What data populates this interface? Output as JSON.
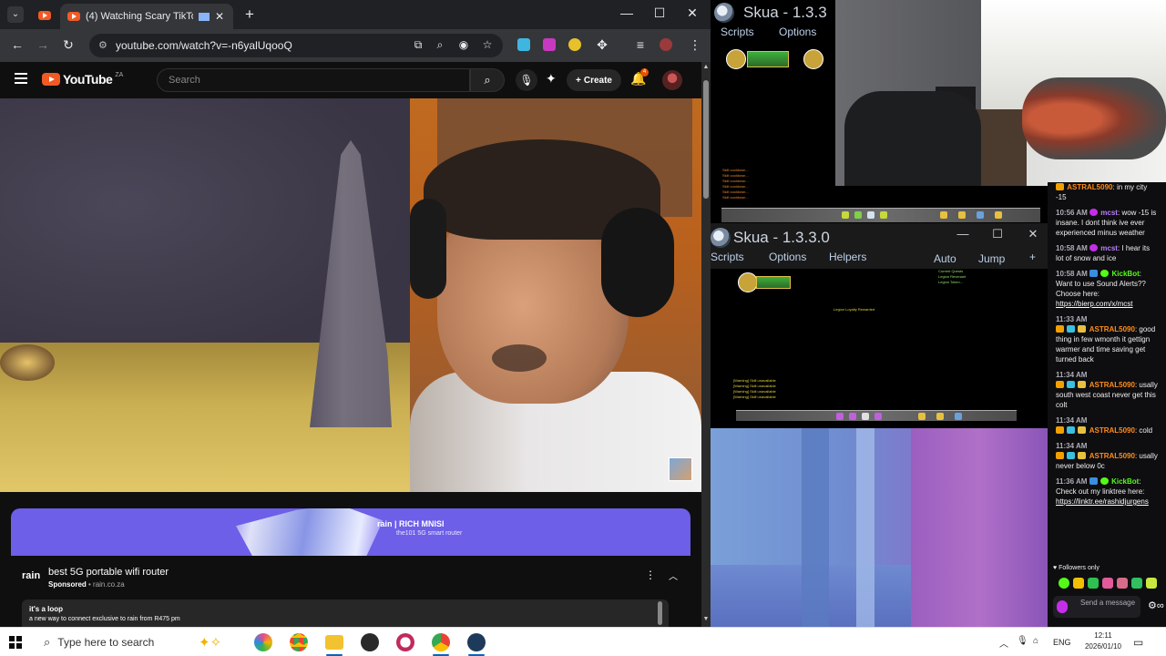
{
  "browser": {
    "tab_title": "(4) Watching Scary TikToks",
    "url": "youtube.com/watch?v=-n6yalUqooQ",
    "tab_close": "✕",
    "new_tab": "+",
    "win_minimize": "—",
    "win_maximize": "☐",
    "win_close": "✕"
  },
  "youtube": {
    "logo_text": "YouTube",
    "country_code": "ZA",
    "search_placeholder": "Search",
    "create_label": "Create",
    "notification_count": "4"
  },
  "ad": {
    "banner_brand": "rain  |  RICH MNISI",
    "banner_tagline": "the101 5G smart router",
    "logo": "rain",
    "title": "best 5G portable wifi router",
    "sponsored": "Sponsored",
    "domain": "rain.co.za",
    "card_title": "it's a loop",
    "card_text": "a new way to connect exclusive to rain from R475 pm"
  },
  "skua": {
    "title_top": "Skua - 1.3.3",
    "title": "Skua - 1.3.3.0",
    "menu_top": [
      "Scripts",
      "Options"
    ],
    "menu": [
      "Scripts",
      "Options",
      "Helpers",
      "Auto",
      "Jump",
      "+"
    ],
    "minimize": "—",
    "maximize": "☐",
    "close": "✕"
  },
  "chat": {
    "messages": [
      {
        "time": "",
        "user": "ASTRAL5090",
        "text": "in my city -15",
        "user_color": "orange"
      },
      {
        "time": "10:56 AM",
        "user": "mcst",
        "text": "wow -15 is insane. I dont think ive ever experienced minus weather",
        "user_color": "purple"
      },
      {
        "time": "10:58 AM",
        "user": "mcst",
        "text": "I hear its lot of snow and ice",
        "user_color": "purple"
      },
      {
        "time": "10:58 AM",
        "user": "KickBot",
        "text": "Want to use Sound Alerts?? Choose here:",
        "link": "https://bierp.com/x/mcst",
        "user_color": "green"
      },
      {
        "time": "11:33 AM",
        "user": "ASTRAL5090",
        "text": "good thing in few wmonth it gettign warmer and time saving get turned back",
        "user_color": "orange"
      },
      {
        "time": "11:34 AM",
        "user": "ASTRAL5090",
        "text": "usally south west coast never get this colt",
        "user_color": "orange"
      },
      {
        "time": "11:34 AM",
        "user": "ASTRAL5090",
        "text": "cold",
        "user_color": "orange"
      },
      {
        "time": "11:34 AM",
        "user": "ASTRAL5090",
        "text": "usally never below 0c",
        "user_color": "orange"
      },
      {
        "time": "11:36 AM",
        "user": "KickBot",
        "text": "Check out my linktree here:",
        "link": "https://linktr.ee/rashidjurgens",
        "user_color": "green"
      }
    ],
    "followers_only": "Followers only",
    "send_placeholder": "Send a message"
  },
  "taskbar": {
    "search_placeholder": "Type here to search",
    "language": "ENG",
    "time": "12:11",
    "date": "2026/01/10"
  },
  "colors": {
    "youtube_red": "#f15a24",
    "ad_purple": "#6d5fe8",
    "kick_green": "#53fc18"
  }
}
